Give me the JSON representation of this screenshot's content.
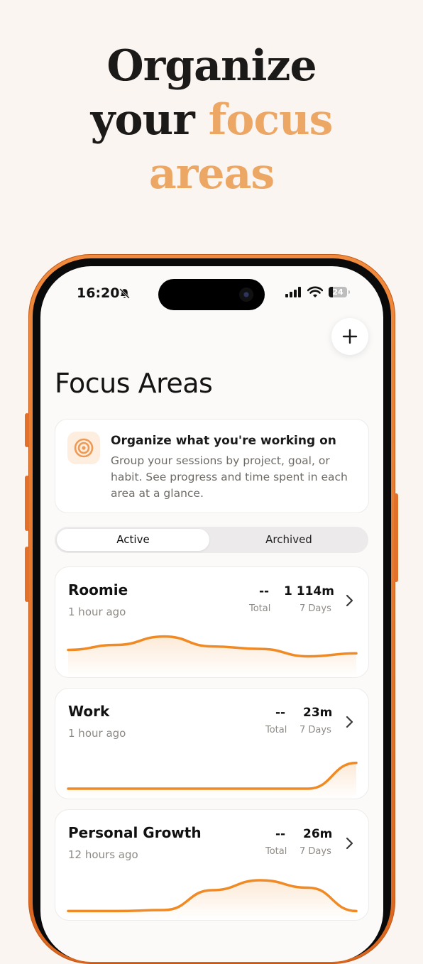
{
  "headline": {
    "line1": "Organize",
    "line2_plain": "your",
    "line2_accent": "focus",
    "line3_accent": "areas"
  },
  "colors": {
    "accent": "#eda764",
    "chart_line": "#f08a24",
    "frame": "#e8762d",
    "background": "#faf5f1"
  },
  "status_bar": {
    "time": "16:20",
    "battery": "24",
    "icons": [
      "bell-slash-icon",
      "signal-icon",
      "wifi-icon",
      "battery-icon"
    ]
  },
  "header": {
    "add_icon": "plus-icon",
    "title": "Focus Areas"
  },
  "info_card": {
    "icon": "target-icon",
    "title": "Organize what you're working on",
    "body": "Group your sessions by project, goal, or habit. See progress and time spent in each area at a glance."
  },
  "tabs": {
    "active_label": "Active",
    "archived_label": "Archived",
    "selected": "Active"
  },
  "focus_areas": [
    {
      "name": "Roomie",
      "updated": "1 hour ago",
      "total_value": "--",
      "total_label": "Total",
      "week_value": "1 114m",
      "week_label": "7 Days",
      "trend": [
        0.45,
        0.55,
        0.72,
        0.52,
        0.47,
        0.32,
        0.38
      ]
    },
    {
      "name": "Work",
      "updated": "1 hour ago",
      "total_value": "--",
      "total_label": "Total",
      "week_value": "23m",
      "week_label": "7 Days",
      "trend": [
        0.1,
        0.1,
        0.1,
        0.1,
        0.1,
        0.1,
        0.62
      ]
    },
    {
      "name": "Personal Growth",
      "updated": "12 hours ago",
      "total_value": "--",
      "total_label": "Total",
      "week_value": "26m",
      "week_label": "7 Days",
      "trend": [
        0.08,
        0.08,
        0.1,
        0.5,
        0.7,
        0.55,
        0.08
      ]
    }
  ]
}
